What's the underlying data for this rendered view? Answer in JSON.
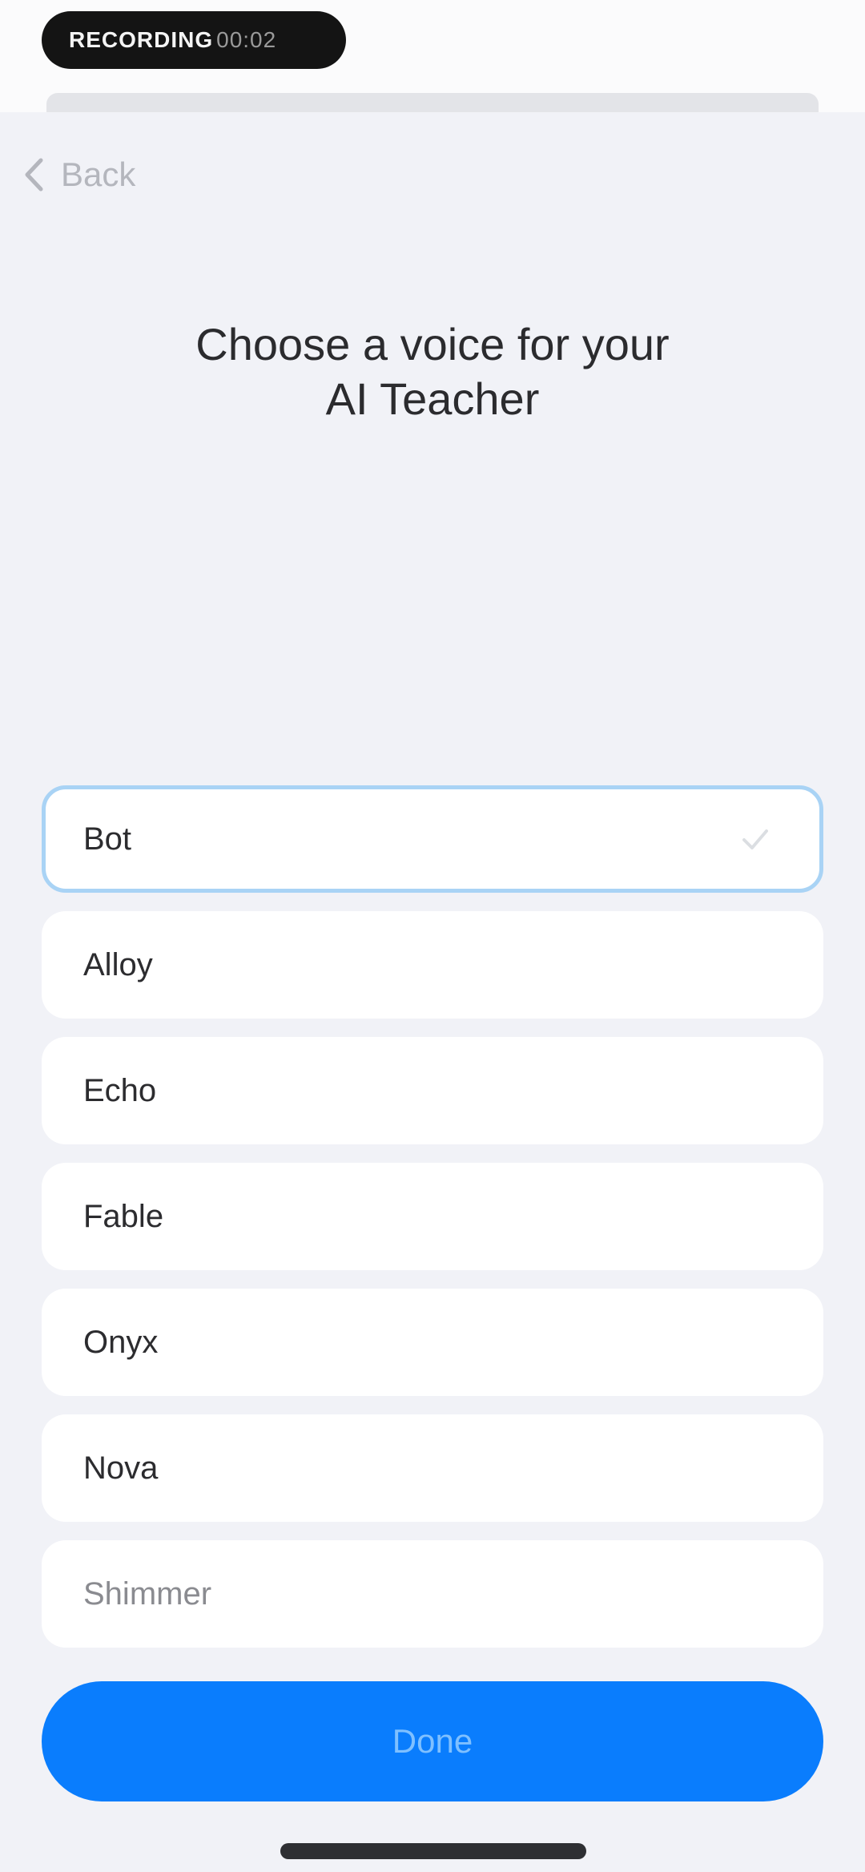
{
  "status_bar": {
    "pill_text": "RECORDING",
    "pill_text_dim": "00:02"
  },
  "nav": {
    "back_label": "Back"
  },
  "header": {
    "title_line1": "Choose a voice for your",
    "title_line2": "AI Teacher"
  },
  "voices": [
    {
      "label": "Bot",
      "selected": true
    },
    {
      "label": "Alloy",
      "selected": false
    },
    {
      "label": "Echo",
      "selected": false
    },
    {
      "label": "Fable",
      "selected": false
    },
    {
      "label": "Onyx",
      "selected": false
    },
    {
      "label": "Nova",
      "selected": false
    },
    {
      "label": "Shimmer",
      "selected": false
    }
  ],
  "actions": {
    "done_label": "Done"
  },
  "colors": {
    "accent": "#0a7dfd",
    "background": "#f1f2f7",
    "selected_border": "#a9d3f5"
  }
}
